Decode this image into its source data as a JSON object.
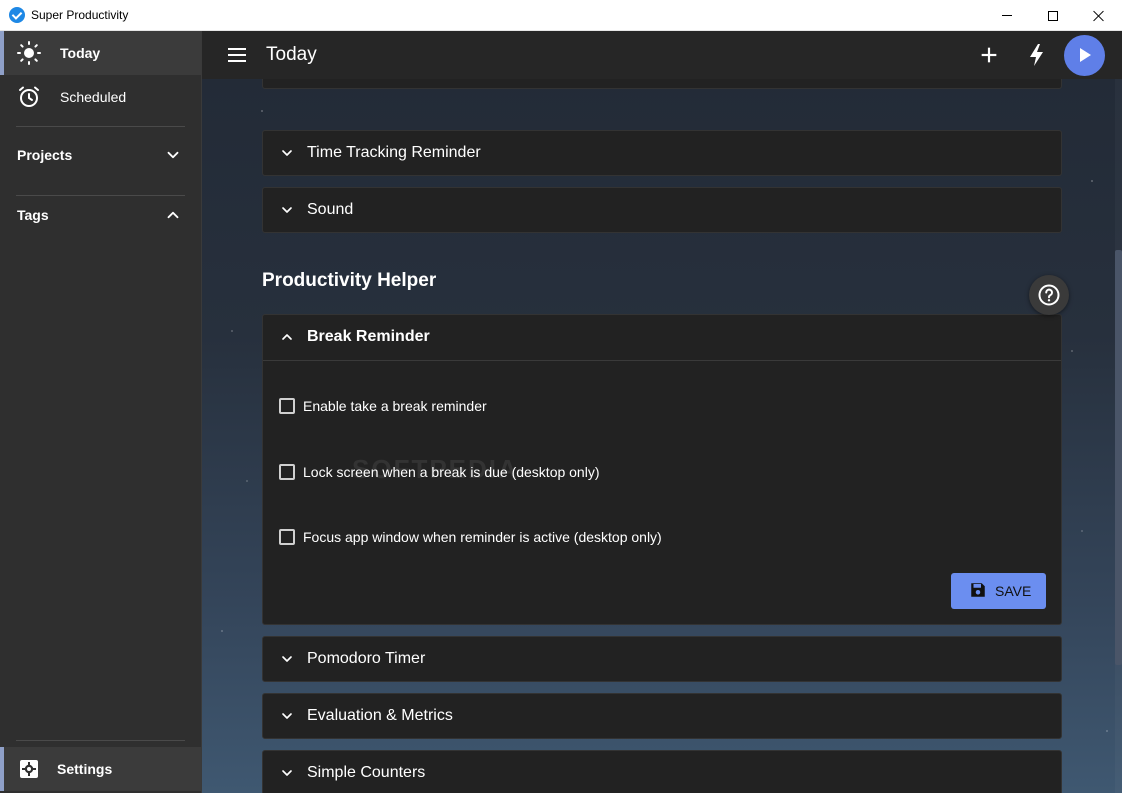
{
  "window": {
    "title": "Super Productivity"
  },
  "sidebar": {
    "items": [
      {
        "label": "Today",
        "icon": "sun-icon",
        "active": true
      },
      {
        "label": "Scheduled",
        "icon": "alarm-clock-icon",
        "active": false
      }
    ],
    "sections": [
      {
        "label": "Projects",
        "expanded": false
      },
      {
        "label": "Tags",
        "expanded": true
      }
    ],
    "settings_label": "Settings"
  },
  "header": {
    "title": "Today"
  },
  "content": {
    "panels_top": [
      {
        "label": "Time Tracking Reminder"
      },
      {
        "label": "Sound"
      }
    ],
    "section_heading": "Productivity Helper",
    "break_reminder": {
      "label": "Break Reminder",
      "options": [
        {
          "label": "Enable take a break reminder",
          "checked": false
        },
        {
          "label": "Lock screen when a break is due (desktop only)",
          "checked": false
        },
        {
          "label": "Focus app window when reminder is active (desktop only)",
          "checked": false
        }
      ],
      "save_label": "SAVE"
    },
    "panels_bottom": [
      {
        "label": "Pomodoro Timer"
      },
      {
        "label": "Evaluation & Metrics"
      },
      {
        "label": "Simple Counters"
      }
    ]
  },
  "watermark": "SOFTPEDIA",
  "colors": {
    "accent": "#6b8ef0",
    "play_button": "#5f7fe8",
    "panel_bg": "#222222",
    "sidebar_bg": "#2f2f2f"
  }
}
